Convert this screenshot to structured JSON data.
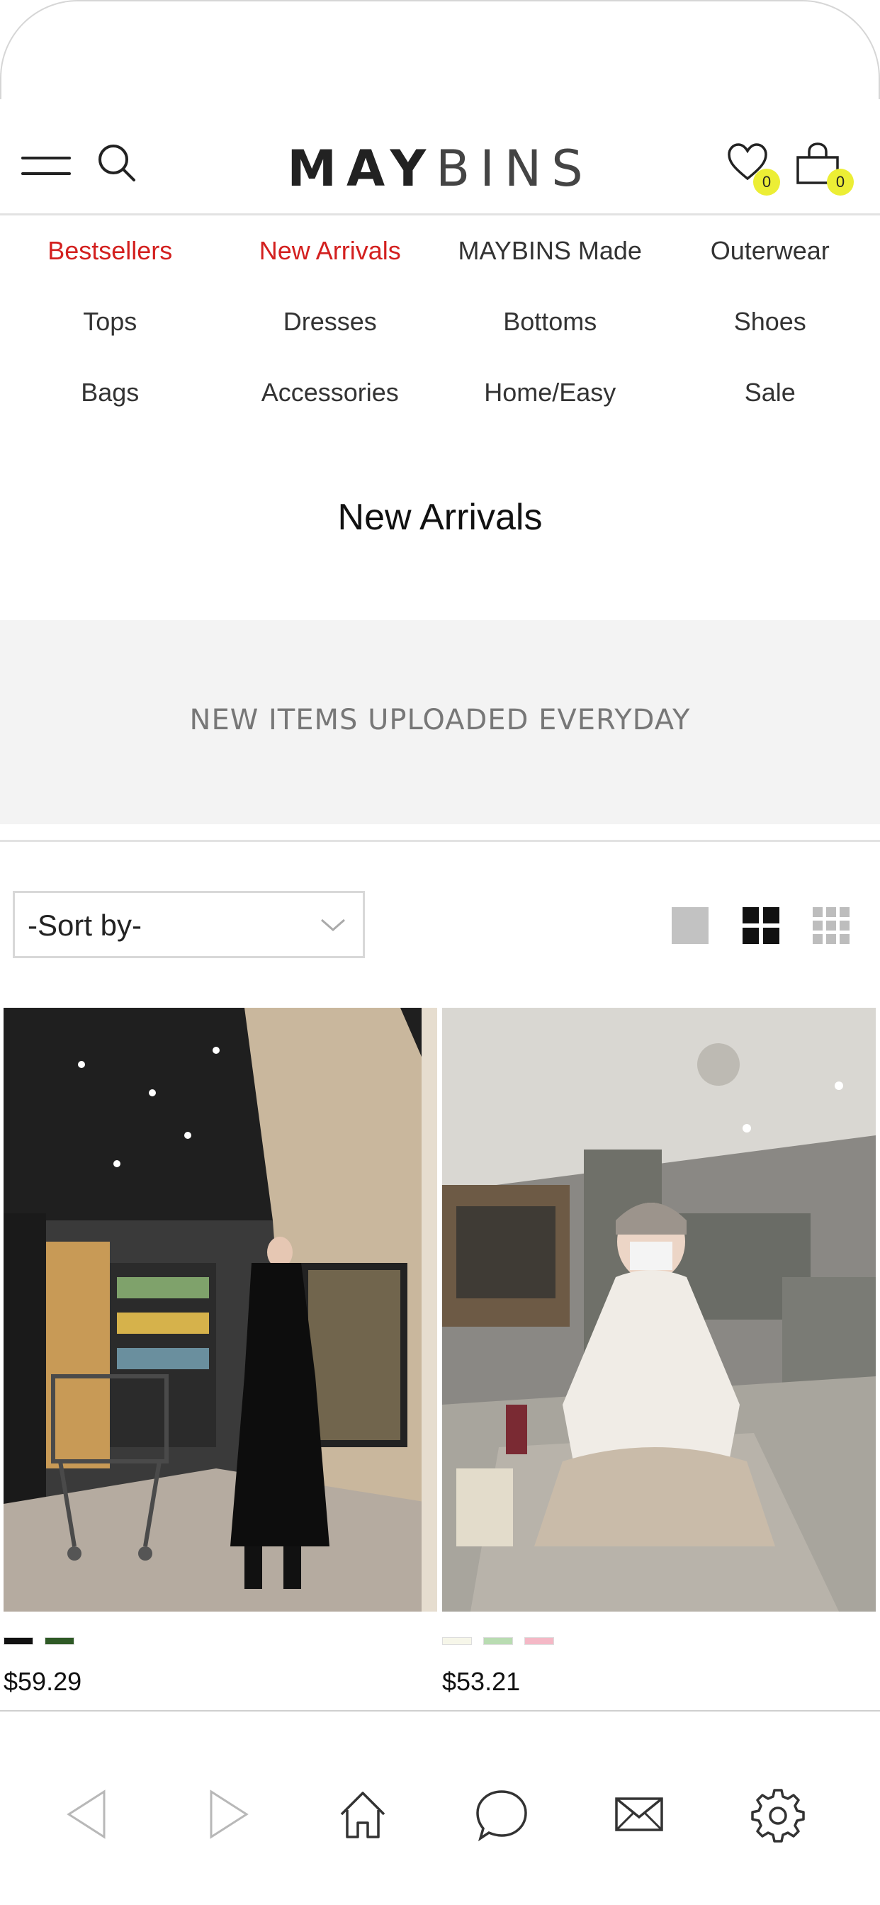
{
  "brand": {
    "part1": "MAY",
    "part2": "BINS"
  },
  "header": {
    "wishlist_count": "0",
    "cart_count": "0"
  },
  "categories": [
    [
      "Bestsellers",
      "New Arrivals",
      "MAYBINS Made",
      "Outerwear"
    ],
    [
      "Tops",
      "Dresses",
      "Bottoms",
      "Shoes"
    ],
    [
      "Bags",
      "Accessories",
      "Home/Easy",
      "Sale"
    ]
  ],
  "highlighted_color": "#d3201f",
  "page": {
    "title": "New Arrivals",
    "banner": "NEW ITEMS UPLOADED EVERYDAY"
  },
  "sort": {
    "selected": "-Sort by-"
  },
  "products": [
    {
      "price": "$59.29",
      "swatches": [
        "#111111",
        "#2f5a26"
      ]
    },
    {
      "price": "$53.21",
      "swatches": [
        "#f6f6e9",
        "#b9dcb2",
        "#f4b8c6"
      ]
    }
  ],
  "icons": {
    "menu": "hamburger-icon",
    "search": "search-icon",
    "wishlist": "heart-icon",
    "cart": "bag-icon",
    "back": "triangle-left-icon",
    "forward": "triangle-right-icon",
    "home": "home-icon",
    "chat": "chat-bubble-icon",
    "mail": "envelope-icon",
    "settings": "gear-icon"
  }
}
